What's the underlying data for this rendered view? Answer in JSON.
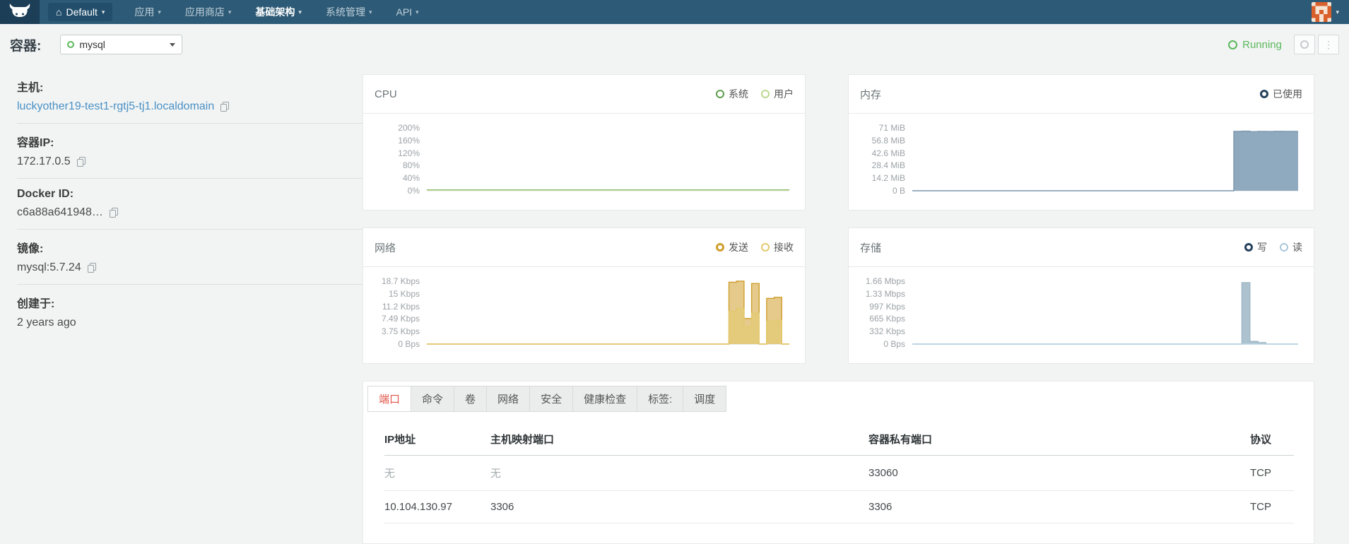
{
  "nav": {
    "environment": "Default",
    "items": [
      {
        "key": "apps",
        "label": "应用"
      },
      {
        "key": "catalog",
        "label": "应用商店"
      },
      {
        "key": "infrastructure",
        "label": "基础架构",
        "active": true
      },
      {
        "key": "admin",
        "label": "系统管理"
      },
      {
        "key": "api",
        "label": "API"
      }
    ]
  },
  "header": {
    "title": "容器:",
    "container": "mysql",
    "status": "Running"
  },
  "sidebar": {
    "fields": [
      {
        "key": "host",
        "label": "主机:",
        "value": "luckyother19-test1-rgtj5-tj1.localdomain",
        "link": true,
        "copy": true
      },
      {
        "key": "container-ip",
        "label": "容器IP:",
        "value": "172.17.0.5",
        "copy": true
      },
      {
        "key": "docker-id",
        "label": "Docker ID:",
        "value": "c6a88a641948…",
        "copy": true
      },
      {
        "key": "image",
        "label": "镜像:",
        "value": "mysql:5.7.24",
        "copy": true
      },
      {
        "key": "created",
        "label": "创建于:",
        "value": "2 years ago"
      }
    ]
  },
  "chart_data": [
    {
      "id": "cpu",
      "type": "area",
      "title": "CPU",
      "ymax": 200,
      "legend_position": "top-right",
      "grid": false,
      "yticks": [
        "200%",
        "160%",
        "120%",
        "80%",
        "40%",
        "0%"
      ],
      "series": [
        {
          "key": "system",
          "name": "系统",
          "color": "#6aa84f",
          "ring_color": "#5b9e4d",
          "ring_weight": 2,
          "n": 48,
          "base": 3,
          "points": {}
        },
        {
          "key": "user",
          "name": "用户",
          "color": "#c6dd9d",
          "ring_color": "#bcd98f",
          "ring_weight": 2,
          "n": 48,
          "base": 1.5,
          "points": {}
        }
      ]
    },
    {
      "id": "memory",
      "type": "area",
      "title": "内存",
      "ymax": 71,
      "legend_position": "top-right",
      "grid": false,
      "yticks": [
        "71 MiB",
        "56.8 MiB",
        "42.6 MiB",
        "28.4 MiB",
        "14.2 MiB",
        "0 B"
      ],
      "series": [
        {
          "key": "used",
          "name": "已使用",
          "color": "#7c97ae",
          "fill": "#8fa9bf",
          "ring_color": "#26435c",
          "ring_weight": 3,
          "n": 48,
          "base": 0,
          "points": {
            "40": 67,
            "41": 67.3,
            "42": 66.8,
            "43": 67.1,
            "44": 66.9,
            "45": 67.2,
            "46": 67,
            "47": 67.1
          }
        }
      ]
    },
    {
      "id": "network",
      "type": "area",
      "title": "网络",
      "ymax": 18.7,
      "legend_position": "top-right",
      "grid": false,
      "yticks": [
        "18.7 Kbps",
        "15 Kbps",
        "11.2 Kbps",
        "7.49 Kbps",
        "3.75 Kbps",
        "0 Bps"
      ],
      "series": [
        {
          "key": "send",
          "name": "发送",
          "color": "#cf9f2e",
          "fill": "rgba(207,159,46,0.55)",
          "ring_color": "#cf9f2e",
          "ring_weight": 3,
          "n": 48,
          "base": 0,
          "points": {
            "40": 18.4,
            "41": 18.7,
            "42": 7.6,
            "43": 18.0,
            "45": 13.6,
            "46": 13.9
          }
        },
        {
          "key": "receive",
          "name": "接收",
          "color": "#e3c96f",
          "fill": "rgba(227,201,111,0.6)",
          "ring_color": "#e3c96f",
          "ring_weight": 2,
          "n": 48,
          "base": 0,
          "points": {
            "40": 9.8,
            "41": 10.6,
            "42": 5.2,
            "43": 9.2,
            "45": 6.8,
            "46": 7.1
          }
        }
      ]
    },
    {
      "id": "storage",
      "type": "area",
      "title": "存储",
      "ymax": 1.66,
      "legend_position": "top-right",
      "grid": false,
      "yticks": [
        "1.66 Mbps",
        "1.33 Mbps",
        "997 Kbps",
        "665 Kbps",
        "332 Kbps",
        "0 Bps"
      ],
      "series": [
        {
          "key": "write",
          "name": "写",
          "color": "#9db7c6",
          "fill": "rgba(157,183,198,0.85)",
          "ring_color": "#26435c",
          "ring_weight": 3,
          "n": 48,
          "base": 0,
          "points": {
            "41": 1.62,
            "42": 0.07,
            "43": 0.04
          }
        },
        {
          "key": "read",
          "name": "读",
          "color": "#b9d2e2",
          "ring_color": "#a9c7da",
          "ring_weight": 2,
          "n": 48,
          "base": 0,
          "points": {}
        }
      ]
    }
  ],
  "detail": {
    "tabs": [
      {
        "key": "ports",
        "label": "端口",
        "active": true
      },
      {
        "key": "command",
        "label": "命令"
      },
      {
        "key": "volumes",
        "label": "卷"
      },
      {
        "key": "network",
        "label": "网络"
      },
      {
        "key": "security",
        "label": "安全"
      },
      {
        "key": "health-check",
        "label": "健康检查"
      },
      {
        "key": "labels",
        "label": "标签:"
      },
      {
        "key": "scheduling",
        "label": "调度"
      }
    ],
    "ports_table": {
      "headers": [
        "IP地址",
        "主机映射端口",
        "容器私有端口",
        "协议"
      ],
      "rows": [
        {
          "cells": [
            "无",
            "无",
            "33060",
            "TCP"
          ],
          "muted": [
            0,
            1
          ]
        },
        {
          "cells": [
            "10.104.130.97",
            "3306",
            "3306",
            "TCP"
          ],
          "muted": []
        }
      ]
    }
  },
  "colors": {
    "nav_bg": "#2d5a76",
    "running_green": "#5cb85c",
    "link_blue": "#4a90c4",
    "active_tab_red": "#e2564a"
  }
}
